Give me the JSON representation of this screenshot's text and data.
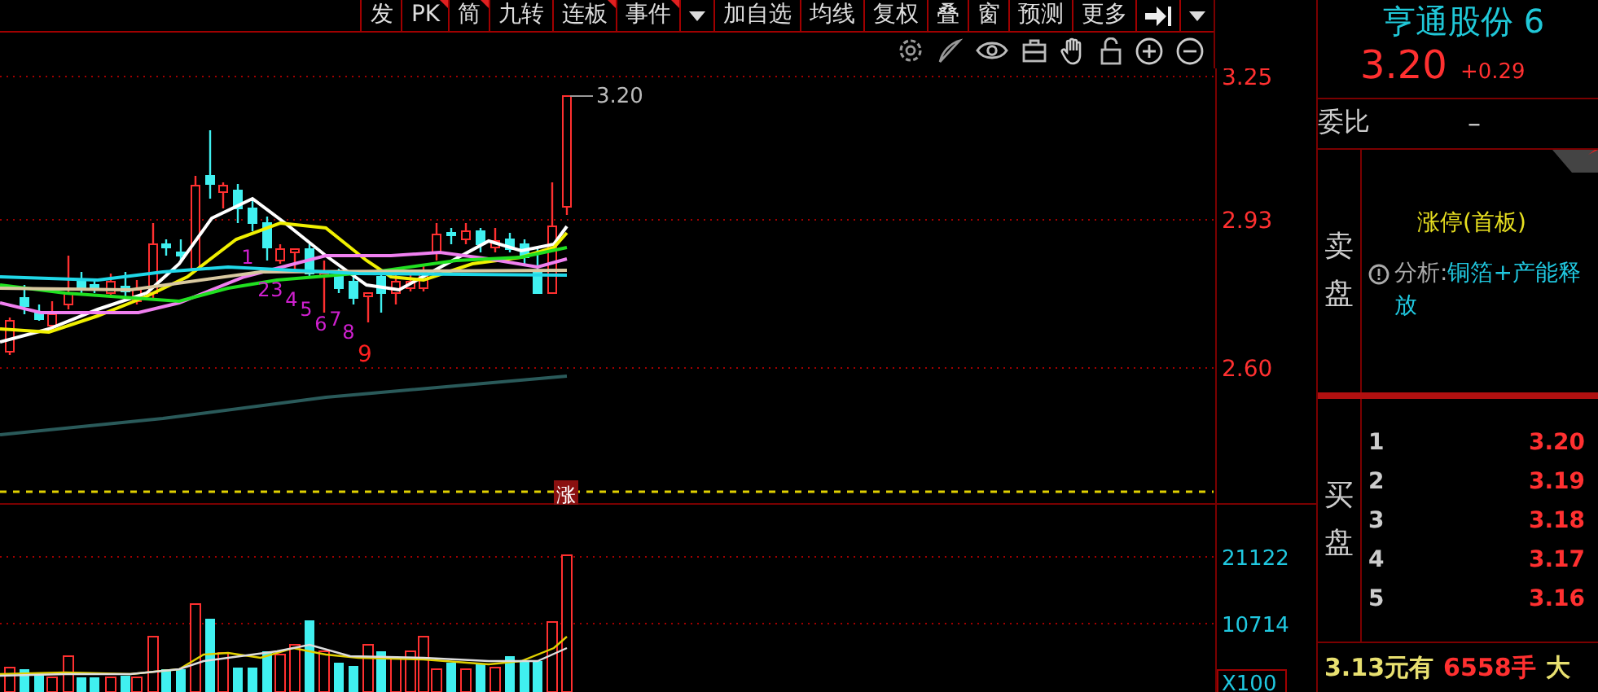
{
  "toolbar": [
    {
      "kind": "text",
      "label": "发",
      "marked": false
    },
    {
      "kind": "text",
      "label": "PK",
      "marked": true
    },
    {
      "kind": "text",
      "label": "简",
      "marked": true
    },
    {
      "kind": "text",
      "label": "九转",
      "marked": false
    },
    {
      "kind": "text",
      "label": "连板",
      "marked": true
    },
    {
      "kind": "text",
      "label": "事件",
      "marked": true
    },
    {
      "kind": "caret"
    },
    {
      "kind": "text",
      "label": "加自选",
      "marked": false
    },
    {
      "kind": "text",
      "label": "均线",
      "marked": false
    },
    {
      "kind": "text",
      "label": "复权",
      "marked": false
    },
    {
      "kind": "text",
      "label": "叠",
      "marked": false
    },
    {
      "kind": "text",
      "label": "窗",
      "marked": false
    },
    {
      "kind": "text",
      "label": "预测",
      "marked": false
    },
    {
      "kind": "text",
      "label": "更多",
      "marked": false
    },
    {
      "kind": "exit"
    },
    {
      "kind": "caret"
    }
  ],
  "price_chart": {
    "axis_labels": [
      "3.25",
      "2.93",
      "2.60"
    ],
    "last_price_label": "3.20",
    "limit_up_badge": "涨",
    "nine_turn": [
      {
        "label": "1",
        "color": "#d020d0"
      },
      {
        "label": "2",
        "color": "#d020d0"
      },
      {
        "label": "3",
        "color": "#d020d0"
      },
      {
        "label": "4",
        "color": "#d020d0"
      },
      {
        "label": "5",
        "color": "#d020d0"
      },
      {
        "label": "6",
        "color": "#d020d0"
      },
      {
        "label": "7",
        "color": "#d020d0"
      },
      {
        "label": "8",
        "color": "#d020d0"
      },
      {
        "label": "9",
        "color": "#ff2020"
      }
    ]
  },
  "volume_chart": {
    "axis_labels": [
      "21122",
      "10714"
    ],
    "unit": "X100"
  },
  "quote": {
    "name": "亨通股份 6",
    "price": "3.20",
    "change": "+0.29",
    "ratio_label": "委比",
    "ratio_value": "–",
    "sell_label": "卖盘",
    "status": "涨停(首板)",
    "analysis_label": "分析:",
    "analysis_text": "铜箔+产能释放",
    "buy_label": "买盘",
    "bids": [
      {
        "rank": "1",
        "price": "3.20"
      },
      {
        "rank": "2",
        "price": "3.19"
      },
      {
        "rank": "3",
        "price": "3.18"
      },
      {
        "rank": "4",
        "price": "3.17"
      },
      {
        "rank": "5",
        "price": "3.16"
      }
    ],
    "footer": [
      {
        "text": "3.13元有",
        "color": "#e8e070"
      },
      {
        "text": "6558手",
        "color": "#ff3030"
      },
      {
        "text": "大",
        "color": "#e8e070"
      }
    ]
  }
}
